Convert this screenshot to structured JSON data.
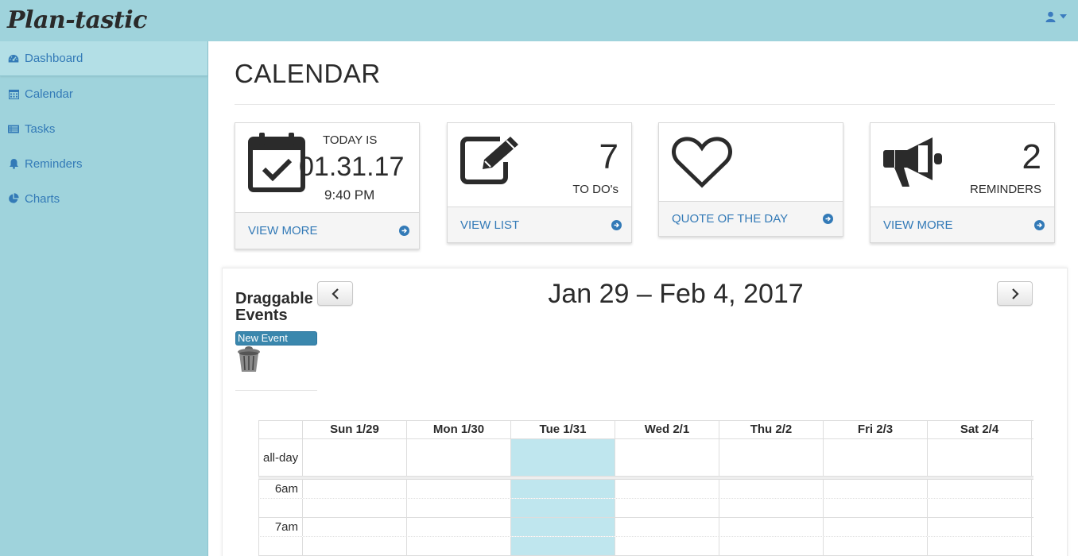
{
  "app": {
    "brand": "Plan-tastic"
  },
  "header": {
    "user_icon": "user-icon",
    "caret_icon": "caret-down-icon"
  },
  "sidebar": {
    "items": [
      {
        "label": "Dashboard",
        "icon": "dashboard-icon",
        "active": true
      },
      {
        "label": "Calendar",
        "icon": "calendar-icon",
        "active": false
      },
      {
        "label": "Tasks",
        "icon": "list-icon",
        "active": false
      },
      {
        "label": "Reminders",
        "icon": "bell-icon",
        "active": false
      },
      {
        "label": "Charts",
        "icon": "pie-chart-icon",
        "active": false
      }
    ]
  },
  "main": {
    "title": "CALENDAR"
  },
  "cards": {
    "today": {
      "label": "TODAY IS",
      "date": "01.31.17",
      "time": "9:40 PM",
      "link": "VIEW MORE",
      "icon": "calendar-check-icon"
    },
    "todos": {
      "count": "7",
      "caption": "TO DO's",
      "link": "VIEW LIST",
      "icon": "edit-icon"
    },
    "quote": {
      "link": "QUOTE OF THE DAY",
      "icon": "heart-icon"
    },
    "reminders": {
      "count": "2",
      "caption": "REMINDERS",
      "link": "VIEW MORE",
      "icon": "bullhorn-icon"
    }
  },
  "calendar": {
    "draggable_title": "Draggable Events",
    "new_event": "New Event",
    "trash_icon": "trash-icon",
    "range": "Jan 29 – Feb 4, 2017",
    "prev_label": "‹",
    "next_label": "›",
    "days": [
      "Sun 1/29",
      "Mon 1/30",
      "Tue 1/31",
      "Wed 2/1",
      "Thu 2/2",
      "Fri 2/3",
      "Sat 2/4"
    ],
    "today_index": 2,
    "allday_label": "all-day",
    "times": [
      "6am",
      "7am"
    ],
    "colors": {
      "today_bg": "#bfe6ee",
      "accent": "#337ab7",
      "event": "#3a87ad",
      "sidebar": "#9fd3dc"
    }
  }
}
